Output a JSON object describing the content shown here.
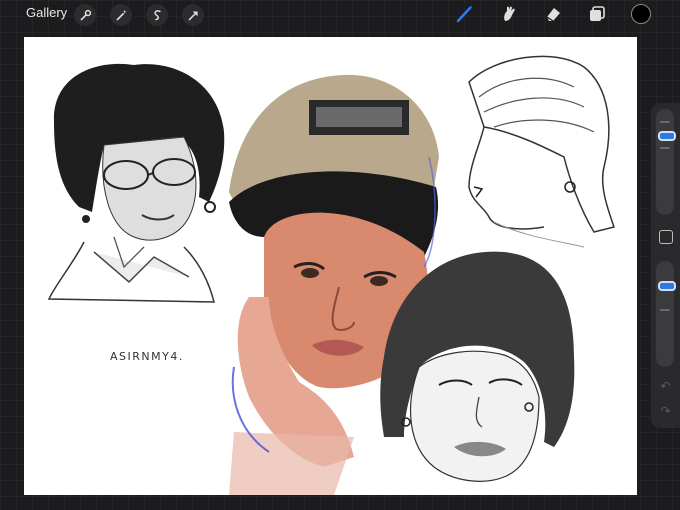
{
  "toolbar": {
    "gallery_label": "Gallery",
    "left_tools": [
      "actions-wrench",
      "adjustments-wand",
      "selection-s",
      "transform-arrow"
    ],
    "right_tools": [
      "brush",
      "smudge",
      "eraser",
      "layers"
    ],
    "active_tool": "brush",
    "accent_color": "#2e7cf6",
    "current_color": "#000000"
  },
  "canvas": {
    "signature_text": "ASIRNMY4."
  },
  "sidebar": {
    "brush_size_level": 0.15,
    "opacity_level": 0.2,
    "modify_button": "square",
    "undo_icon": "undo-arrow",
    "redo_icon": "redo-arrow"
  }
}
